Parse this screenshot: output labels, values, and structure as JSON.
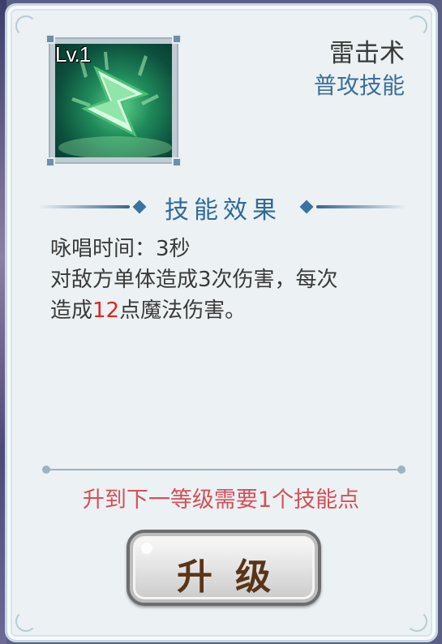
{
  "skill": {
    "level": "Lv.1",
    "name": "雷击术",
    "type": "普攻技能",
    "icon": "lightning-arrow-icon"
  },
  "effect": {
    "section_title": "技能效果",
    "cast_time": "咏唱时间：3秒",
    "line_1": "对敌方单体造成3次伤害，每次",
    "line_2_prefix": "造成",
    "line_2_value": "12",
    "line_2_suffix": "点魔法伤害。"
  },
  "upgrade": {
    "requirement": "升到下一等级需要1个技能点",
    "button_label": "升级"
  },
  "colors": {
    "panel": "#ecf1f3",
    "accent_blue": "#3b6f9b",
    "highlight_red": "#e02424",
    "requirement_red": "#d4505a"
  }
}
